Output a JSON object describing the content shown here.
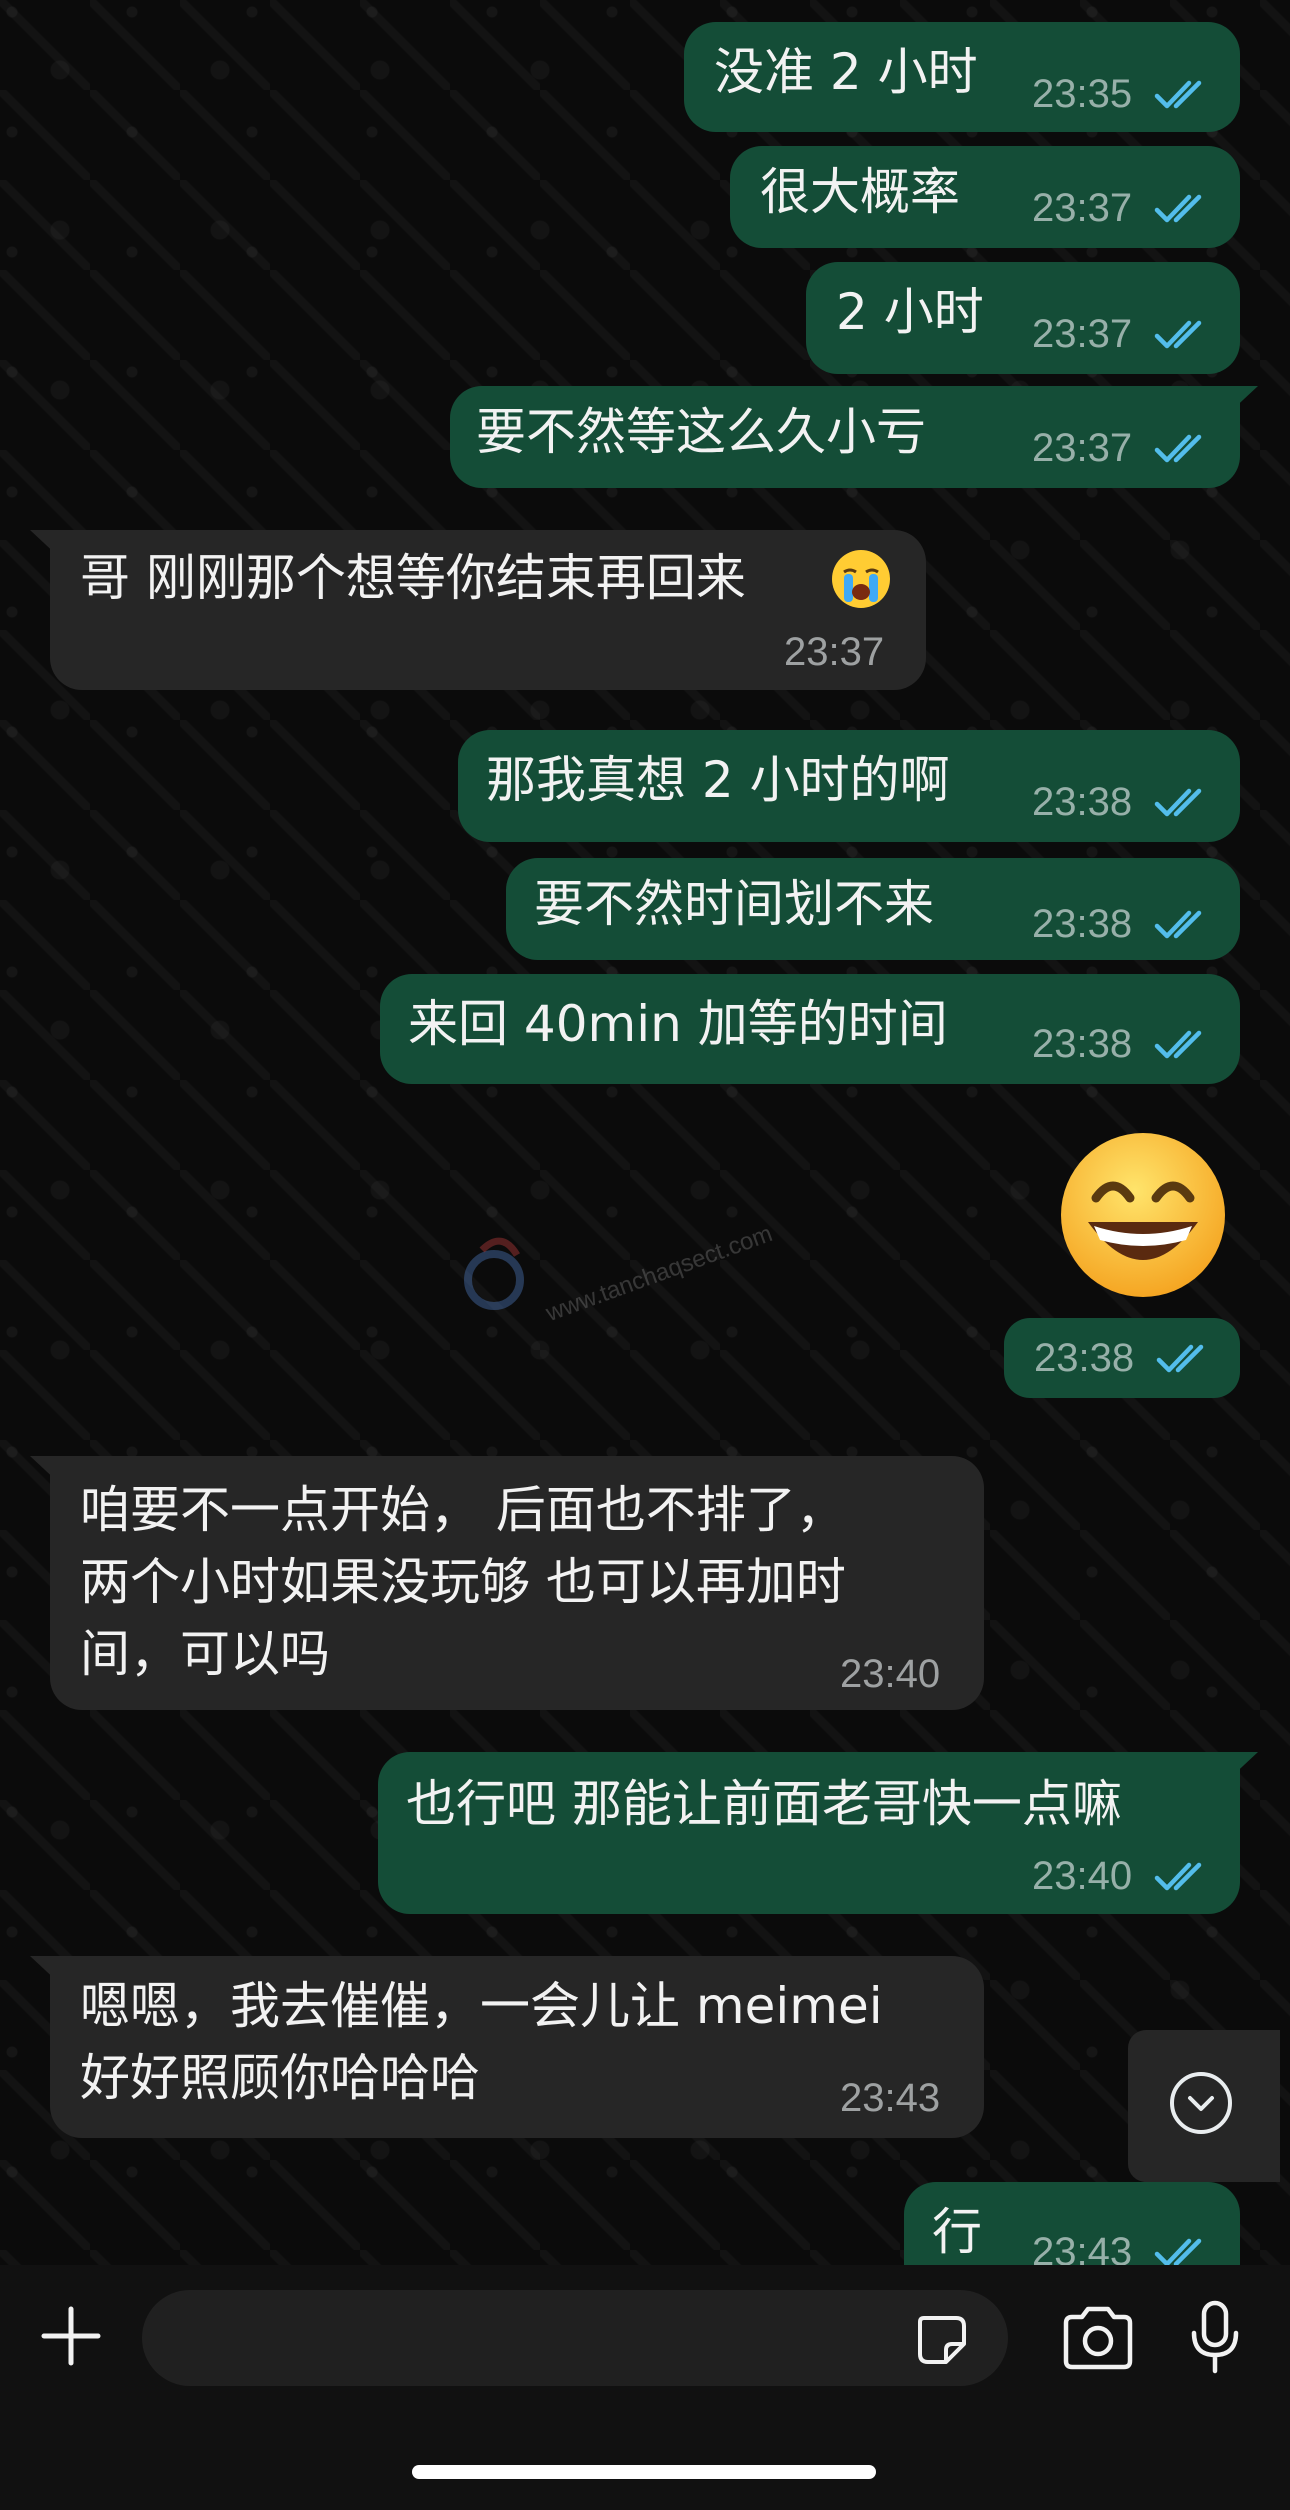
{
  "messages": [
    {
      "dir": "out",
      "text": "没准 2 小时",
      "time": "23:35"
    },
    {
      "dir": "out",
      "text": "很大概率",
      "time": "23:37"
    },
    {
      "dir": "out",
      "text": "2 小时",
      "time": "23:37"
    },
    {
      "dir": "out",
      "text": "要不然等这么久小亏",
      "time": "23:37"
    },
    {
      "dir": "in",
      "text": "哥 刚刚那个想等你结束再回来",
      "emoji": "loudly-crying-face",
      "time": "23:37"
    },
    {
      "dir": "out",
      "text": "那我真想 2 小时的啊",
      "time": "23:38"
    },
    {
      "dir": "out",
      "text": "要不然时间划不来",
      "time": "23:38"
    },
    {
      "dir": "out",
      "text": "来回 40min 加等的时间",
      "time": "23:38"
    },
    {
      "dir": "out",
      "emoji": "grinning-face-with-smiling-eyes",
      "time": "23:38"
    },
    {
      "dir": "in",
      "lines": [
        "咱要不一点开始， 后面也不排了，",
        "两个小时如果没玩够 也可以再加时",
        "间，可以吗"
      ],
      "time": "23:40"
    },
    {
      "dir": "out",
      "text": "也行吧 那能让前面老哥快一点嘛",
      "time": "23:40"
    },
    {
      "dir": "in",
      "lines": [
        "嗯嗯，我去催催，一会儿让 meimei",
        "好好照顾你哈哈哈"
      ],
      "time": "23:43"
    },
    {
      "dir": "out",
      "text": "行",
      "time": "23:43"
    }
  ],
  "watermark": "www.tanchaqsect.com",
  "colors": {
    "outgoing_bubble": "#144d37",
    "incoming_bubble": "#262626",
    "read_ticks": "#53bdeb",
    "background": "#0b0b0b"
  },
  "composer": {
    "left_icon": "plus-icon",
    "right_icons": [
      "sticker-icon",
      "camera-icon",
      "microphone-icon"
    ],
    "placeholder": ""
  },
  "scroll_button_icon": "chevron-down-icon"
}
